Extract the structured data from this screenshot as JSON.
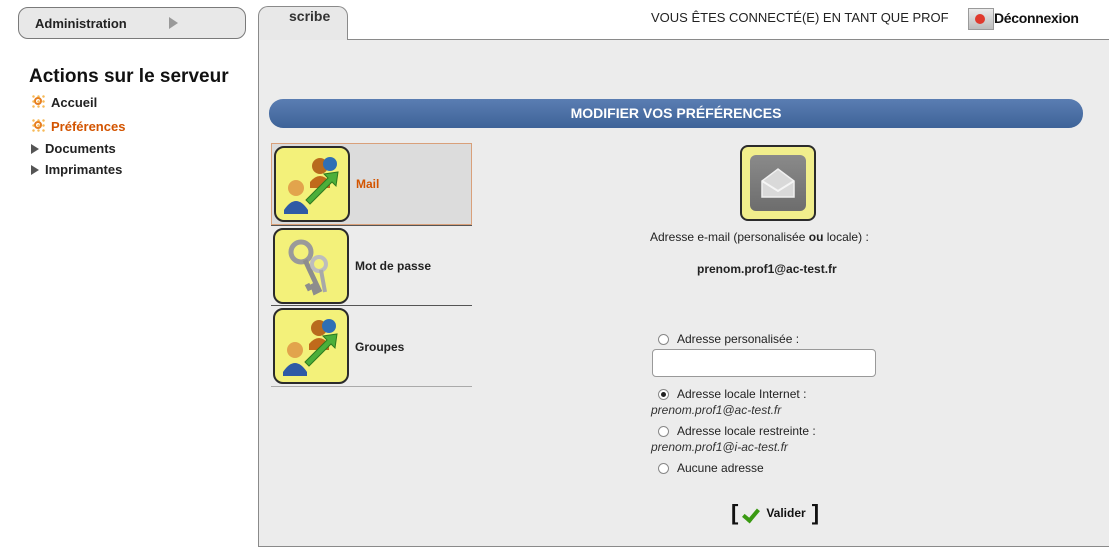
{
  "topnav": {
    "admin_label": "Administration",
    "tab_label": "scribe",
    "connected_text": "VOUS ÊTES CONNECTÉ(E) EN TANT QUE PROF",
    "logout_label": "Déconnexion"
  },
  "sidebar": {
    "title": "Actions sur le serveur",
    "items": [
      {
        "label": "Accueil",
        "icon": "sun-icon",
        "active": false
      },
      {
        "label": "Préférences",
        "icon": "sun-icon",
        "active": true
      },
      {
        "label": "Documents",
        "icon": "triangle-icon",
        "active": false
      },
      {
        "label": "Imprimantes",
        "icon": "triangle-icon",
        "active": false
      }
    ]
  },
  "panel": {
    "title": "MODIFIER VOS PRÉFÉRENCES",
    "menu": [
      {
        "label": "Mail",
        "icon": "users-arrow-icon",
        "selected": true
      },
      {
        "label": "Mot de passe",
        "icon": "keys-icon",
        "selected": false
      },
      {
        "label": "Groupes",
        "icon": "users-arrow-icon",
        "selected": false
      }
    ],
    "form": {
      "email_label_pre": "Adresse e-mail (personalisée ",
      "email_label_bold": "ou",
      "email_label_post": " locale) :",
      "current_email": "prenom.prof1@ac-test.fr",
      "options": [
        {
          "label": "Adresse personalisée :",
          "checked": false
        },
        {
          "label": "Adresse locale Internet :",
          "checked": true,
          "address": "prenom.prof1@ac-test.fr"
        },
        {
          "label": "Adresse locale restreinte :",
          "checked": false,
          "address": "prenom.prof1@i-ac-test.fr"
        },
        {
          "label": "Aucune adresse",
          "checked": false
        }
      ],
      "custom_value": "",
      "bracket_open": "[",
      "submit_label": "Valider",
      "bracket_close": "]"
    }
  },
  "colors": {
    "header_bar": "#4a6fa5",
    "active_orange": "#d35400",
    "icon_yellow": "#f3f17a"
  }
}
